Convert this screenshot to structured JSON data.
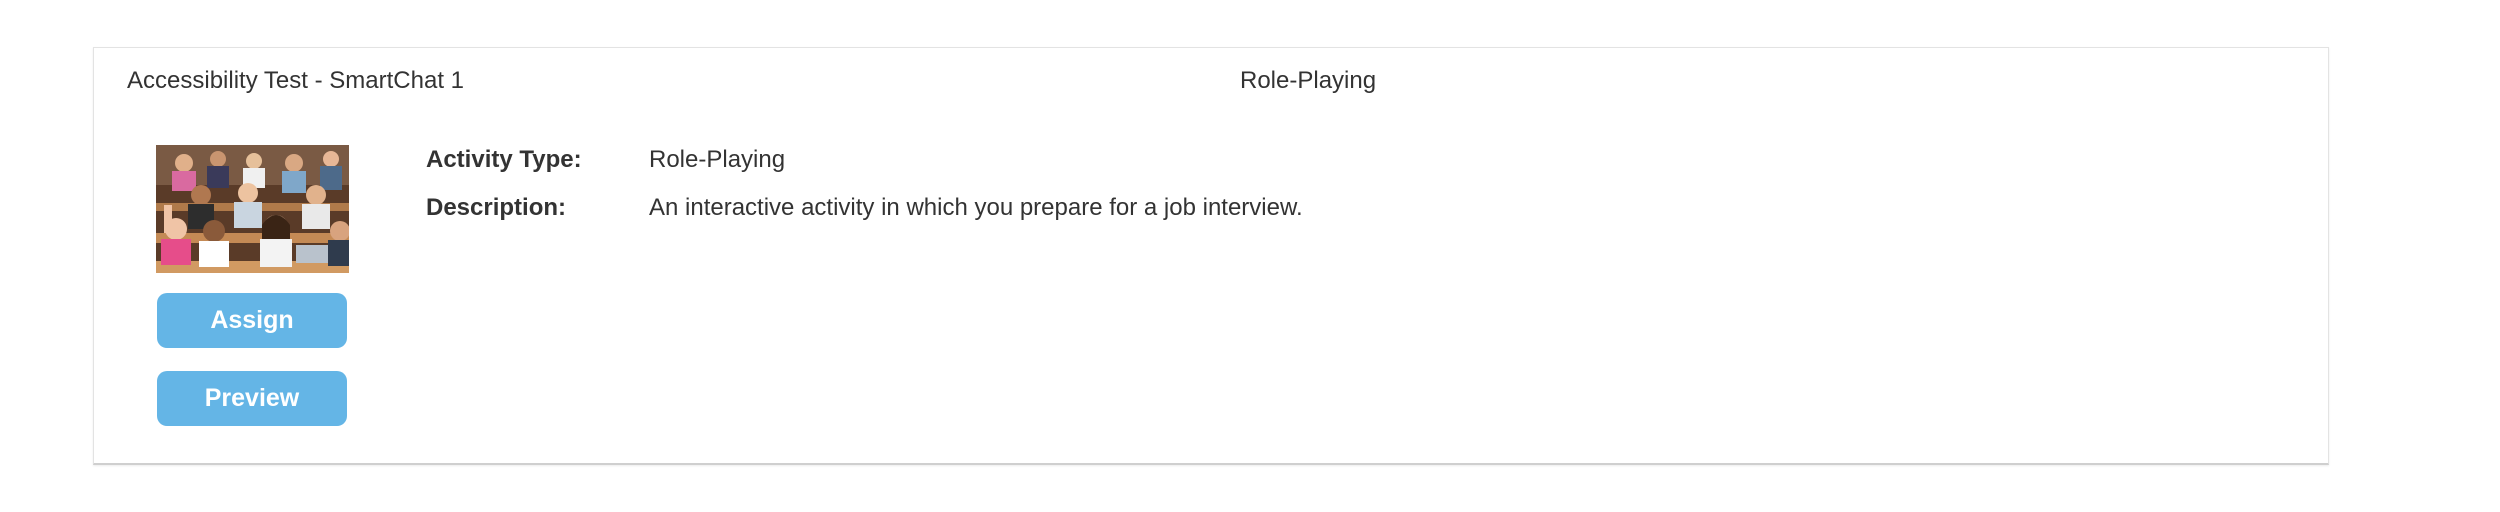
{
  "activity_card": {
    "title": "Accessibility Test - SmartChat 1",
    "type_heading": "Role-Playing",
    "thumbnail": {
      "icon": "classroom-students-photo"
    },
    "buttons": {
      "assign_label": "Assign",
      "preview_label": "Preview"
    },
    "details": [
      {
        "label": "Activity Type:",
        "value": "Role-Playing"
      },
      {
        "label": "Description:",
        "value": "An interactive activity in which you prepare for a job interview."
      }
    ]
  },
  "colors": {
    "button_bg": "#64b5e6",
    "button_text": "#ffffff",
    "text": "#333333",
    "card_border": "#e3e3e3"
  }
}
